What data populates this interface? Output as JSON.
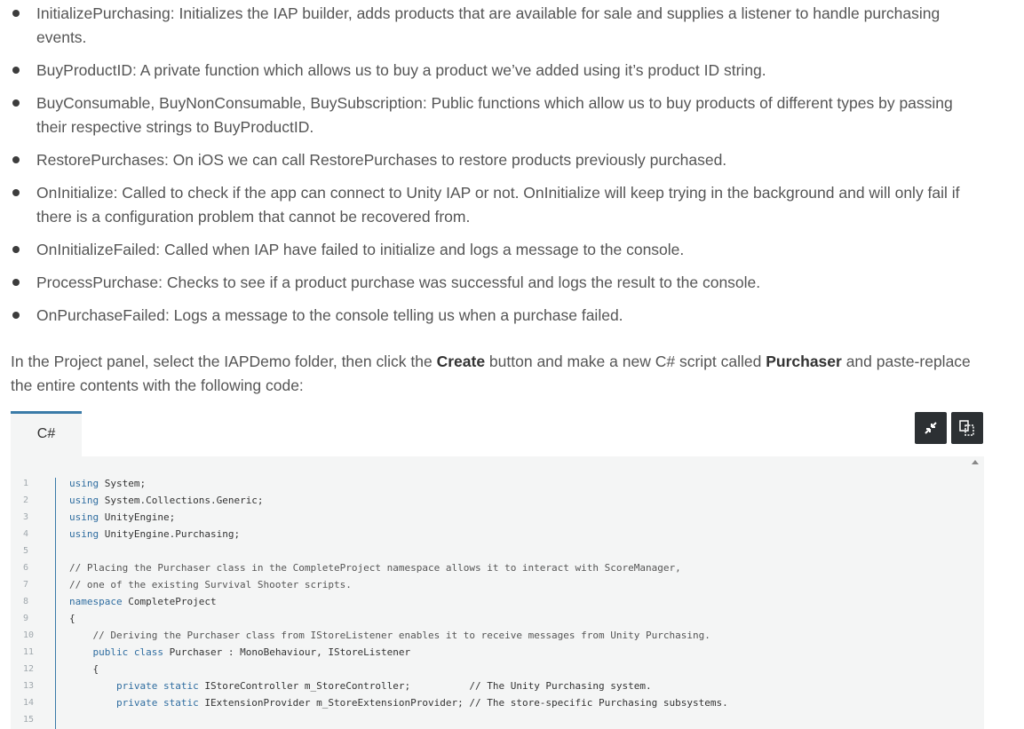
{
  "bullets": [
    {
      "line1": "InitializePurchasing: Initializes the IAP builder, adds products that are available for sale and supplies a listener to handle purchasing",
      "line2": "events."
    },
    {
      "line1": "BuyProductID: A private function which allows us to buy a product we’ve added using it’s product ID string.",
      "line2": ""
    },
    {
      "line1": "BuyConsumable, BuyNonConsumable, BuySubscription: Public functions which allow us to buy products of different types by passing",
      "line2": "their respective strings to BuyProductID."
    },
    {
      "line1": "RestorePurchases: On iOS we can call RestorePurchases to restore products previously purchased.",
      "line2": ""
    },
    {
      "line1": "OnInitialize: Called to check if the app can connect to Unity IAP or not. OnInitialize will keep trying in the background and will only fail if",
      "line2": "there is a configuration problem that cannot be recovered from."
    },
    {
      "line1": "OnInitializeFailed: Called when IAP have failed to initialize and logs a message to the console.",
      "line2": ""
    },
    {
      "line1": "ProcessPurchase: Checks to see if a product purchase was successful and logs the result to the console.",
      "line2": ""
    },
    {
      "line1": "OnPurchaseFailed: Logs a message to the console telling us when a purchase failed.",
      "line2": ""
    }
  ],
  "intro": {
    "part1": "In the Project panel, select the IAPDemo folder, then click the ",
    "create": "Create",
    "part2": " button and make a new C# script called ",
    "purchaser": "Purchaser",
    "part3": " and paste-replace",
    "line2": "the entire contents with the following code:"
  },
  "tab_label": "C#",
  "toolbar": {
    "collapse_icon": "collapse-arrows-icon",
    "copy_icon": "copy-icon"
  },
  "code_lines": [
    {
      "n": "1",
      "kw": "using",
      "rest": " System;",
      "indent": ""
    },
    {
      "n": "2",
      "kw": "using",
      "rest": " System.Collections.Generic;",
      "indent": ""
    },
    {
      "n": "3",
      "kw": "using",
      "rest": " UnityEngine;",
      "indent": ""
    },
    {
      "n": "4",
      "kw": "using",
      "rest": " UnityEngine.Purchasing;",
      "indent": ""
    },
    {
      "n": "5",
      "kw": "",
      "rest": "",
      "indent": ""
    },
    {
      "n": "6",
      "kw": "",
      "rest": "// Placing the Purchaser class in the CompleteProject namespace allows it to interact with ScoreManager,",
      "indent": ""
    },
    {
      "n": "7",
      "kw": "",
      "rest": "// one of the existing Survival Shooter scripts.",
      "indent": ""
    },
    {
      "n": "8",
      "kw": "namespace",
      "rest": " CompleteProject",
      "indent": ""
    },
    {
      "n": "9",
      "kw": "",
      "rest": "{",
      "indent": ""
    },
    {
      "n": "10",
      "kw": "",
      "rest": "// Deriving the Purchaser class from IStoreListener enables it to receive messages from Unity Purchasing.",
      "indent": "    "
    },
    {
      "n": "11",
      "kw": "public class",
      "rest": " Purchaser : MonoBehaviour, IStoreListener",
      "indent": "    "
    },
    {
      "n": "12",
      "kw": "",
      "rest": "{",
      "indent": "    "
    },
    {
      "n": "13",
      "kw": "private static",
      "rest": " IStoreController m_StoreController;          // The Unity Purchasing system.",
      "indent": "        "
    },
    {
      "n": "14",
      "kw": "private static",
      "rest": " IExtensionProvider m_StoreExtensionProvider; // The store-specific Purchasing subsystems.",
      "indent": "        "
    },
    {
      "n": "15",
      "kw": "",
      "rest": "",
      "indent": ""
    }
  ],
  "colors": {
    "accent": "#3a7ba8",
    "code_bg": "#f4f5f5",
    "button_bg": "#2c3033"
  }
}
